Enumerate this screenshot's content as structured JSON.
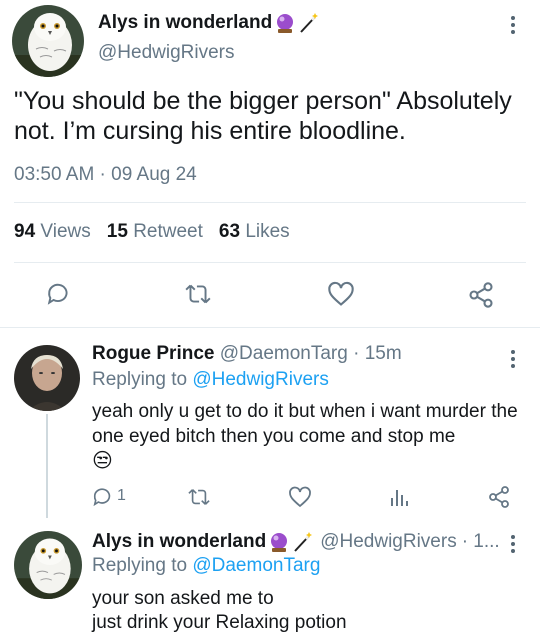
{
  "main_tweet": {
    "author_name": "Alys in wonderland",
    "author_handle": "@HedwigRivers",
    "text": "\"You should be the bigger person\" Absolutely not. I’m cursing his entire bloodline.",
    "timestamp": "03:50 AM · 09 Aug 24",
    "stats": {
      "views_count": "94",
      "views_label": "Views",
      "retweets_count": "15",
      "retweets_label": "Retweet",
      "likes_count": "63",
      "likes_label": "Likes"
    }
  },
  "replies": [
    {
      "author_name": "Rogue Prince",
      "author_handle": "@DaemonTarg",
      "time": "· 15m",
      "replying_prefix": "Replying to",
      "replying_to": "@HedwigRivers",
      "text": "yeah only u get to do it but when i want murder the one eyed bitch  then you come and stop me",
      "emoji": "😒",
      "reply_count": "1"
    },
    {
      "author_name": "Alys in wonderland",
      "author_handle": "@HedwigRivers",
      "time": "· 1...",
      "replying_prefix": "Replying to",
      "replying_to": "@DaemonTarg",
      "text_line1": "your son asked me to",
      "text_line2": "just drink your Relaxing potion"
    }
  ],
  "icons": {
    "name_decoration": [
      "crystal-ball-icon",
      "magic-wand-icon"
    ],
    "actions": [
      "reply-icon",
      "retweet-icon",
      "like-icon",
      "analytics-icon",
      "share-icon"
    ]
  },
  "colors": {
    "link": "#1da1f2",
    "secondary_text": "#657786",
    "icon": "#657786",
    "divider": "#e6ecf0",
    "crystal_ball": "#9b4dcc"
  }
}
